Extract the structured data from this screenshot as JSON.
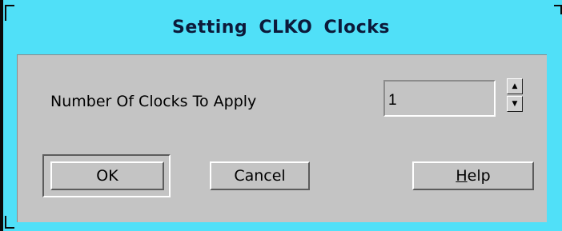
{
  "dialog": {
    "title": "Setting  CLKO Clocks",
    "field_label": "Number Of Clocks To Apply",
    "clocks_value": "1",
    "buttons": {
      "ok": "OK",
      "cancel": "Cancel",
      "help_mnemonic": "H",
      "help_rest": "elp"
    }
  },
  "icons": {
    "spin_up": "arrow-up-icon",
    "spin_down": "arrow-down-icon"
  },
  "colors": {
    "titlebar": "#50e0f8",
    "panel": "#c4c4c4",
    "title_text": "#0c1a3a"
  }
}
